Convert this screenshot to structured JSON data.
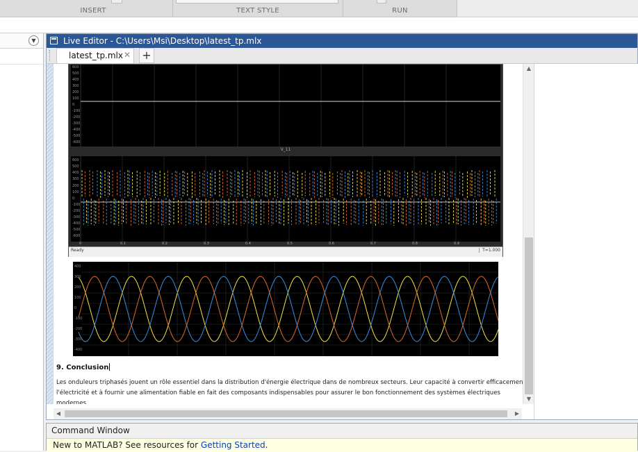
{
  "ribbon": {
    "sections": [
      "INSERT",
      "TEXT STYLE",
      "RUN"
    ]
  },
  "editor": {
    "title": "Live Editor - C:\\Users\\Msi\\Desktop\\latest_tp.mlx",
    "tab_label": "latest_tp.mlx",
    "tab_close": "✕",
    "tab_add": "+"
  },
  "figure1": {
    "top_yticks": [
      "600",
      "500",
      "400",
      "300",
      "200",
      "100",
      "0",
      "-100",
      "-200",
      "-300",
      "-400",
      "-500",
      "-600"
    ],
    "bottom_title": "V_11",
    "bottom_yticks": [
      "600",
      "500",
      "400",
      "300",
      "200",
      "100",
      "0",
      "-100",
      "-200",
      "-300",
      "-400",
      "-500",
      "-600"
    ],
    "xticks": [
      "0",
      "0.1",
      "0.2",
      "0.3",
      "0.4",
      "0.5",
      "0.6",
      "0.7",
      "0.8",
      "0.9"
    ],
    "status_left": "Ready",
    "status_right": "T=1.000"
  },
  "figure2": {
    "yticks": [
      "400",
      "300",
      "200",
      "100",
      "0",
      "-100",
      "-200",
      "-300",
      "-400"
    ]
  },
  "section": {
    "heading": "9. Conclusion",
    "paragraph": "Les onduleurs triphasés jouent un rôle essentiel dans la distribution d'énergie électrique dans de nombreux secteurs. Leur capacité à convertir efficacement l'électricité et à fournir une alimentation fiable en fait des composants indispensables pour assurer le bon fonctionnement des systèmes électriques modernes."
  },
  "scroll": {
    "up": "▲",
    "down": "▼",
    "left": "◀",
    "right": "▶"
  },
  "left_panel": {
    "menu_icon": "▼"
  },
  "command_window": {
    "title": "Command Window",
    "message_prefix": "New to MATLAB? See resources for ",
    "link_text": "Getting Started",
    "message_suffix": "."
  },
  "colors": {
    "title_bar": "#2b5797",
    "phase_a": "#f5e642",
    "phase_b": "#3b8fe0",
    "phase_c": "#e06a2a",
    "link": "#0b3fb3"
  }
}
